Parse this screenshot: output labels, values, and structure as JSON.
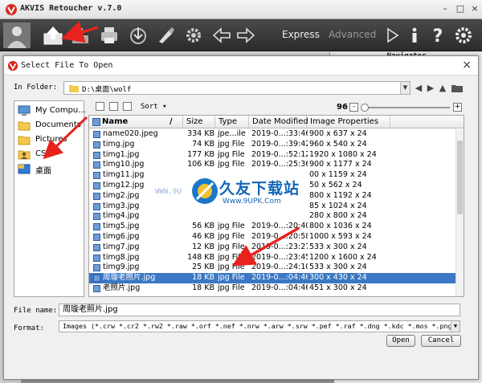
{
  "app": {
    "title": "AKVIS Retoucher v.7.0",
    "window_controls": [
      "–",
      "□",
      "×"
    ],
    "modes": {
      "express": "Express",
      "advanced": "Advanced"
    },
    "navigator_title": "Navigator"
  },
  "dialog": {
    "title": "Select File To Open",
    "close": "×",
    "in_folder_label": "In Folder:",
    "folder_path": "D:\\桌面\\wolf",
    "places": [
      {
        "label": "My Compu...",
        "icon": "computer-icon"
      },
      {
        "label": "Documents",
        "icon": "folder-icon"
      },
      {
        "label": "Pictures",
        "icon": "folder-icon"
      },
      {
        "label": "CS",
        "icon": "user-icon"
      },
      {
        "label": "桌面",
        "icon": "desktop-icon"
      }
    ],
    "sort_label": "Sort",
    "zoom_value": "96",
    "zoom_level_percent": 0,
    "columns": [
      "Name",
      "Size",
      "Type",
      "Date Modified",
      "Image Properties"
    ],
    "files": [
      {
        "name": "name020.jpeg",
        "size": "334 KB",
        "type": "jpe...ile",
        "date": "2019-0...:33:46",
        "props": "900 x 637 x 24"
      },
      {
        "name": "timg.jpg",
        "size": "74 KB",
        "type": "jpg File",
        "date": "2019-0...:39:42",
        "props": "960 x 540 x 24"
      },
      {
        "name": "timg1.jpg",
        "size": "177 KB",
        "type": "jpg File",
        "date": "2019-0...:52:12",
        "props": "1920 x 1080 x 24"
      },
      {
        "name": "timg10.jpg",
        "size": "106 KB",
        "type": "jpg File",
        "date": "2019-0...:25:36",
        "props": "900 x 1177 x 24"
      },
      {
        "name": "timg11.jpg",
        "size": "",
        "type": "",
        "date": "",
        "props": "00 x 1159 x 24"
      },
      {
        "name": "timg12.jpg",
        "size": "",
        "type": "",
        "date": "",
        "props": "50 x 562 x 24"
      },
      {
        "name": "timg2.jpg",
        "size": "",
        "type": "",
        "date": "",
        "props": "800 x 1192 x 24"
      },
      {
        "name": "timg3.jpg",
        "size": "",
        "type": "",
        "date": "",
        "props": "85 x 1024 x 24"
      },
      {
        "name": "timg4.jpg",
        "size": "",
        "type": "",
        "date": "",
        "props": "280 x 800 x 24"
      },
      {
        "name": "timg5.jpg",
        "size": "56 KB",
        "type": "jpg File",
        "date": "2019-0...:20:40",
        "props": "800 x 1036 x 24"
      },
      {
        "name": "timg6.jpg",
        "size": "46 KB",
        "type": "jpg File",
        "date": "2019-0...:20:58",
        "props": "1000 x 593 x 24"
      },
      {
        "name": "timg7.jpg",
        "size": "12 KB",
        "type": "jpg File",
        "date": "2019-0...:23:27",
        "props": "533 x 300 x 24"
      },
      {
        "name": "timg8.jpg",
        "size": "148 KB",
        "type": "jpg File",
        "date": "2019-0...:23:45",
        "props": "1200 x 1600 x 24"
      },
      {
        "name": "timg9.jpg",
        "size": "25 KB",
        "type": "jpg File",
        "date": "2019-0...:24:10",
        "props": "533 x 300 x 24"
      },
      {
        "name": "周璇老照片.jpg",
        "size": "18 KB",
        "type": "jpg File",
        "date": "2019-0...:04:46",
        "props": "300 x 430 x 24",
        "selected": true
      },
      {
        "name": "老照片.jpg",
        "size": "18 KB",
        "type": "jpg File",
        "date": "2019-0...:04:46",
        "props": "451 x 300 x 24"
      }
    ],
    "file_name_label": "File name:",
    "file_name_value": "周璇老照片.jpg",
    "format_label": "Format:",
    "format_value": "Images (*.crw *.cr2 *.rw2 *.raw *.orf *.nef *.nrw *.arw *.srw *.pef *.raf *.dng *.kdc *.mos *.png *.bmp *.",
    "open_button": "Open",
    "cancel_button": "Cancel"
  },
  "watermark": {
    "left_text": "WWW.9U",
    "chinese": "久友下载站",
    "url": "Www.9UPK.Com"
  },
  "colors": {
    "toolbar": "#333333",
    "selection": "#3b77c4",
    "arrow": "#e8231e",
    "watermark": "#1466b8"
  }
}
